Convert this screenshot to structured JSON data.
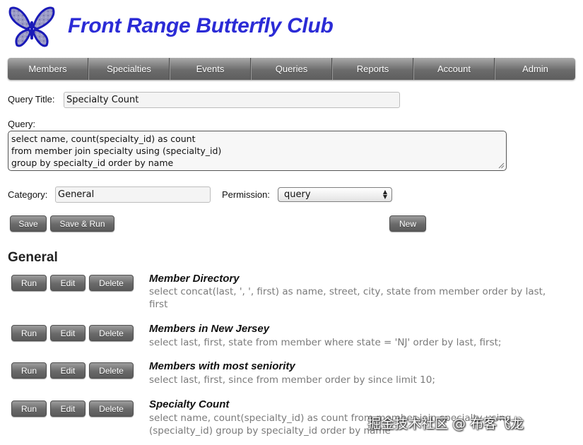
{
  "header": {
    "site_title": "Front Range Butterfly Club",
    "logo_icon": "butterfly-icon",
    "brand_color": "#2b2bd6"
  },
  "nav": {
    "items": [
      "Members",
      "Specialties",
      "Events",
      "Queries",
      "Reports",
      "Account",
      "Admin"
    ]
  },
  "form": {
    "query_title_label": "Query Title:",
    "query_title_value": "Specialty Count",
    "query_label": "Query:",
    "query_lines": [
      "select name, count(specialty_id) as count",
      "from member join specialty using (specialty_id)",
      "group by specialty_id order by name"
    ],
    "category_label": "Category:",
    "category_value": "General",
    "permission_label": "Permission:",
    "permission_value": "query",
    "save_label": "Save",
    "save_run_label": "Save & Run",
    "new_label": "New"
  },
  "section": {
    "heading": "General",
    "run_label": "Run",
    "edit_label": "Edit",
    "delete_label": "Delete",
    "queries": [
      {
        "title": "Member Directory",
        "sql": "select concat(last, ', ', first) as name, street, city, state from member order by last, first"
      },
      {
        "title": "Members in New Jersey",
        "sql": "select last, first, state from member where state = 'NJ' order by last, first;"
      },
      {
        "title": "Members with most seniority",
        "sql": "select last, first, since from member order by since limit 10;"
      },
      {
        "title": "Specialty Count",
        "sql": "select name, count(specialty_id) as count from member join specialty using (specialty_id) group by specialty_id order by name"
      }
    ]
  },
  "watermark": "掘金技术社区 @ 布客飞龙"
}
